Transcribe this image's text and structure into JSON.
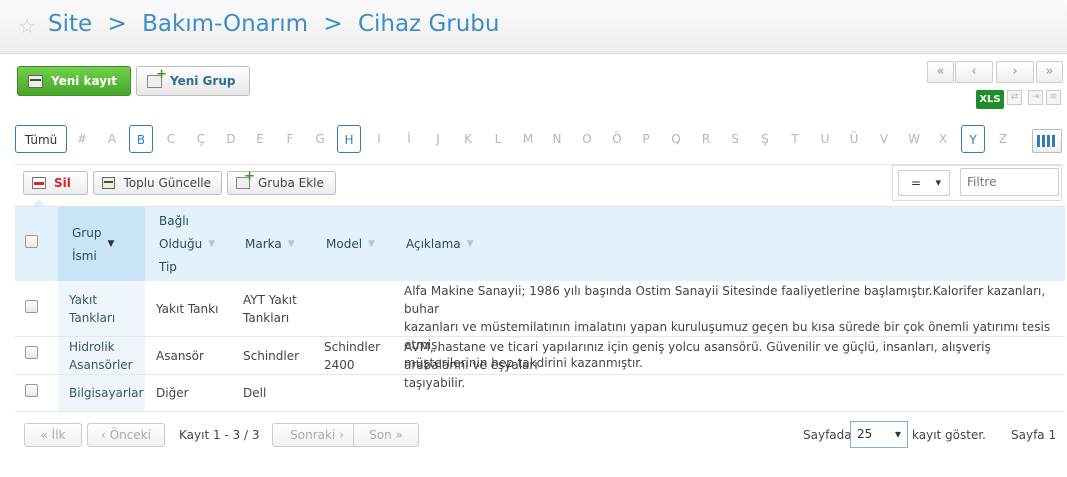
{
  "header": {
    "crumbs": [
      "Site",
      ">",
      "Bakım-Onarım",
      ">",
      "Cihaz Grubu"
    ]
  },
  "toolbar": {
    "new_record": "Yeni kayıt",
    "new_group": "Yeni Grup"
  },
  "pager_top": {
    "first": "«",
    "prev": "‹",
    "next": "›",
    "last": "»"
  },
  "export": {
    "xls": "XLS"
  },
  "alphabet": {
    "all": "Tümü",
    "letters": [
      "#",
      "A",
      "B",
      "C",
      "Ç",
      "D",
      "E",
      "F",
      "G",
      "H",
      "I",
      "İ",
      "J",
      "K",
      "L",
      "M",
      "N",
      "O",
      "Ö",
      "P",
      "Q",
      "R",
      "S",
      "Ş",
      "T",
      "U",
      "Ü",
      "V",
      "W",
      "X",
      "Y",
      "Z"
    ],
    "active": [
      "B",
      "H",
      "Y"
    ]
  },
  "actions": {
    "delete": "Sil",
    "bulk_update": "Toplu Güncelle",
    "add_to_group": "Gruba Ekle"
  },
  "filter": {
    "operator": "=",
    "placeholder": "Filtre"
  },
  "columns": {
    "group_name": [
      "Grup",
      "İsmi"
    ],
    "bound_type": [
      "Bağlı",
      "Olduğu",
      "Tip"
    ],
    "brand": "Marka",
    "model": "Model",
    "description": "Açıklama"
  },
  "rows": [
    {
      "group_name": [
        "Yakıt",
        "Tankları"
      ],
      "bound_type": "Yakıt Tankı",
      "brand": [
        "AYT Yakıt",
        "Tankları"
      ],
      "model": [],
      "description": [
        "Alfa Makine Sanayii; 1986 yılı başında Ostim Sanayii Sitesinde faaliyetlerine başlamıştır.Kalorifer kazanları, buhar",
        "kazanları ve müstemilatının imalatını yapan kuruluşumuz geçen bu kısa sürede bir çok önemli yatırımı tesis etmiş,",
        "müşterilerinin hep takdirini kazanmıştır."
      ]
    },
    {
      "group_name": [
        "Hidrolik",
        "Asansörler"
      ],
      "bound_type": "Asansör",
      "brand": [
        "Schindler"
      ],
      "model": [
        "Schindler",
        "2400"
      ],
      "description": [
        "AVM, hastane ve ticari yapılarınız için geniş yolcu asansörü. Güvenilir ve güçlü, insanları, alışveriş arabalarını ve eşyaları",
        "taşıyabilir."
      ]
    },
    {
      "group_name": [
        "Bilgisayarlar"
      ],
      "bound_type": "Diğer",
      "brand": [
        "Dell"
      ],
      "model": [],
      "description": []
    }
  ],
  "footer": {
    "first": "« İlk",
    "prev": "‹ Önceki",
    "record_info": "Kayıt 1 - 3 / 3",
    "next": "Sonraki ›",
    "last": "Son »",
    "per_page_prefix": "Sayfada",
    "per_page_value": "25",
    "per_page_suffix": "kayıt göster.",
    "page": "Sayfa 1"
  }
}
